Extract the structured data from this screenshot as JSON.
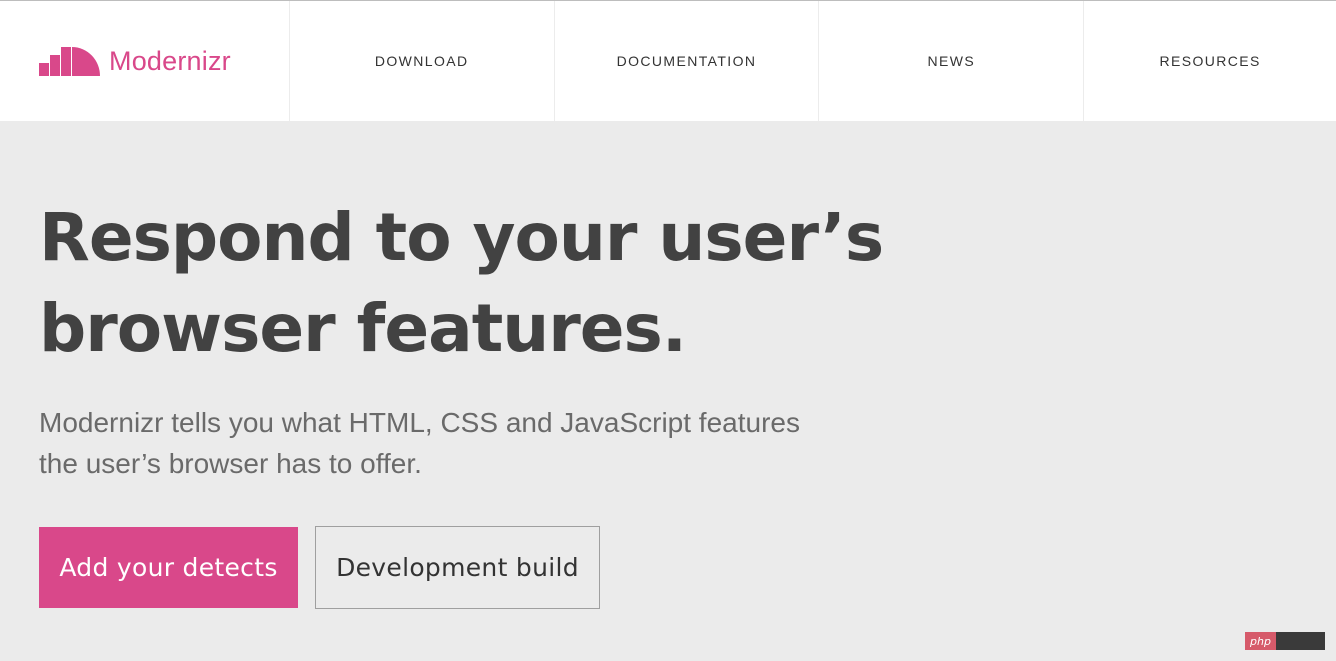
{
  "brand": {
    "name": "Modernizr",
    "color": "#d9488a"
  },
  "nav": {
    "items": [
      {
        "label": "DOWNLOAD"
      },
      {
        "label": "DOCUMENTATION"
      },
      {
        "label": "NEWS"
      },
      {
        "label": "RESOURCES"
      }
    ]
  },
  "hero": {
    "title_line1": "Respond to your user’s",
    "title_line2": "browser features.",
    "subtitle_line1": "Modernizr tells you what HTML, CSS and JavaScript features",
    "subtitle_line2": "the user’s browser has to offer."
  },
  "actions": {
    "primary_label": "Add your detects",
    "secondary_label": "Development build"
  },
  "watermark": {
    "text": "php"
  }
}
